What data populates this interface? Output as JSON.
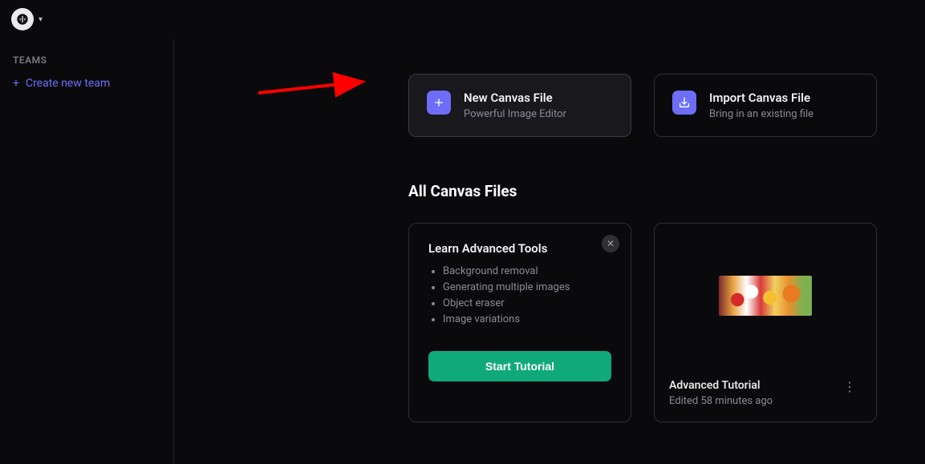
{
  "sidebar": {
    "heading": "TEAMS",
    "create_label": "Create new team"
  },
  "actions": {
    "new_canvas": {
      "title": "New Canvas File",
      "subtitle": "Powerful Image Editor"
    },
    "import_canvas": {
      "title": "Import Canvas File",
      "subtitle": "Bring in an existing file"
    }
  },
  "section_title": "All Canvas Files",
  "tutorial": {
    "title": "Learn Advanced Tools",
    "items": [
      "Background removal",
      "Generating multiple images",
      "Object eraser",
      "Image variations"
    ],
    "button": "Start Tutorial"
  },
  "file": {
    "title": "Advanced Tutorial",
    "edited": "Edited 58 minutes ago"
  }
}
